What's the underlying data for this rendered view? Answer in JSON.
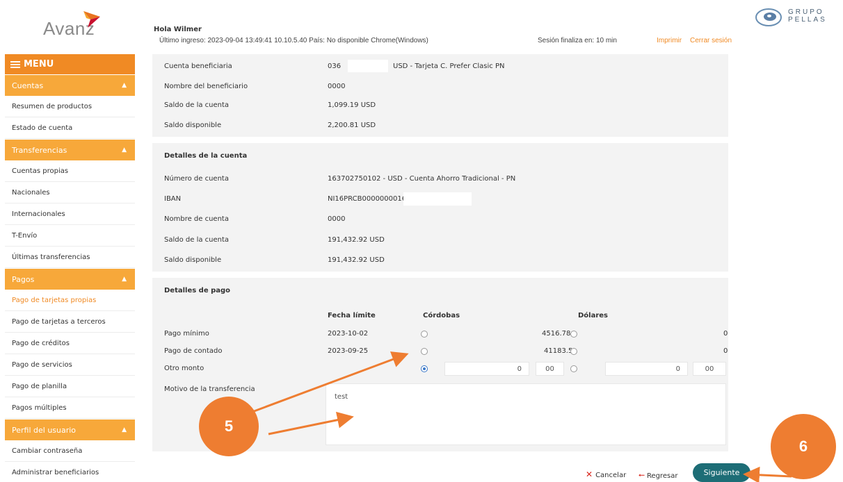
{
  "branding": {
    "logo_text": "Avanz",
    "partner_logo_text_line1": "GRUPO",
    "partner_logo_text_line2": "PELLAS",
    "brand_color": "#f08a24",
    "section_color": "#f7a83a",
    "primary_button_color": "#1d6d76"
  },
  "header": {
    "greeting": "Hola Wilmer",
    "last_login": "Último ingreso: 2023-09-04 13:49:41 10.10.5.40 País: No disponible Chrome(Windows)",
    "session_ends": "Sesión finaliza en: 10 min",
    "print": "Imprimir",
    "logout": "Cerrar sesión"
  },
  "sidebar": {
    "menu_label": "MENU",
    "sections": [
      {
        "label": "Cuentas",
        "items": [
          "Resumen de productos",
          "Estado de cuenta"
        ]
      },
      {
        "label": "Transferencias",
        "items": [
          "Cuentas propias",
          "Nacionales",
          "Internacionales",
          "T-Envío",
          "Últimas transferencias"
        ]
      },
      {
        "label": "Pagos",
        "items": [
          "Pago de tarjetas propias",
          "Pago de tarjetas a terceros",
          "Pago de créditos",
          "Pago de servicios",
          "Pago de planilla",
          "Pagos múltiples"
        ]
      },
      {
        "label": "Perfil del usuario",
        "items": [
          "Cambiar contraseña",
          "Administrar beneficiarios"
        ]
      }
    ],
    "active_item": "Pago de tarjetas propias"
  },
  "beneficiary": {
    "rows": [
      {
        "label": "Cuenta beneficiaria",
        "value_prefix": "036",
        "value_suffix": "USD - Tarjeta C. Prefer Clasic PN"
      },
      {
        "label": "Nombre del beneficiario",
        "value": "0000"
      },
      {
        "label": "Saldo de la cuenta",
        "value": "1,099.19 USD"
      },
      {
        "label": "Saldo disponible",
        "value": "2,200.81 USD"
      }
    ]
  },
  "account_details": {
    "title": "Detalles de la cuenta",
    "rows": [
      {
        "label": "Número de cuenta",
        "value": "163702750102 - USD - Cuenta Ahorro Tradicional - PN"
      },
      {
        "label": "IBAN",
        "value": "NI16PRCB0000000016"
      },
      {
        "label": "Nombre de cuenta",
        "value": "0000"
      },
      {
        "label": "Saldo de la cuenta",
        "value": "191,432.92 USD"
      },
      {
        "label": "Saldo disponible",
        "value": "191,432.92 USD"
      }
    ]
  },
  "payment_details": {
    "title": "Detalles de pago",
    "col_date": "Fecha límite",
    "col_cordobas": "Córdobas",
    "col_dolares": "Dólares",
    "rows": [
      {
        "label": "Pago mínimo",
        "date": "2023-10-02",
        "cordobas": "4516.78",
        "dolares": "0"
      },
      {
        "label": "Pago de contado",
        "date": "2023-09-25",
        "cordobas": "41183.5",
        "dolares": "0"
      }
    ],
    "other_amount": {
      "label": "Otro monto",
      "cordobas_int": "0",
      "cordobas_dec": "00",
      "dolares_int": "0",
      "dolares_dec": "00",
      "selected": "cordobas"
    },
    "reason_label": "Motivo de la transferencia",
    "reason_value": "test"
  },
  "actions": {
    "cancel": "Cancelar",
    "back": "Regresar",
    "next": "Siguiente"
  },
  "annotations": {
    "step5": "5",
    "step6": "6",
    "color": "#ee7d31"
  }
}
